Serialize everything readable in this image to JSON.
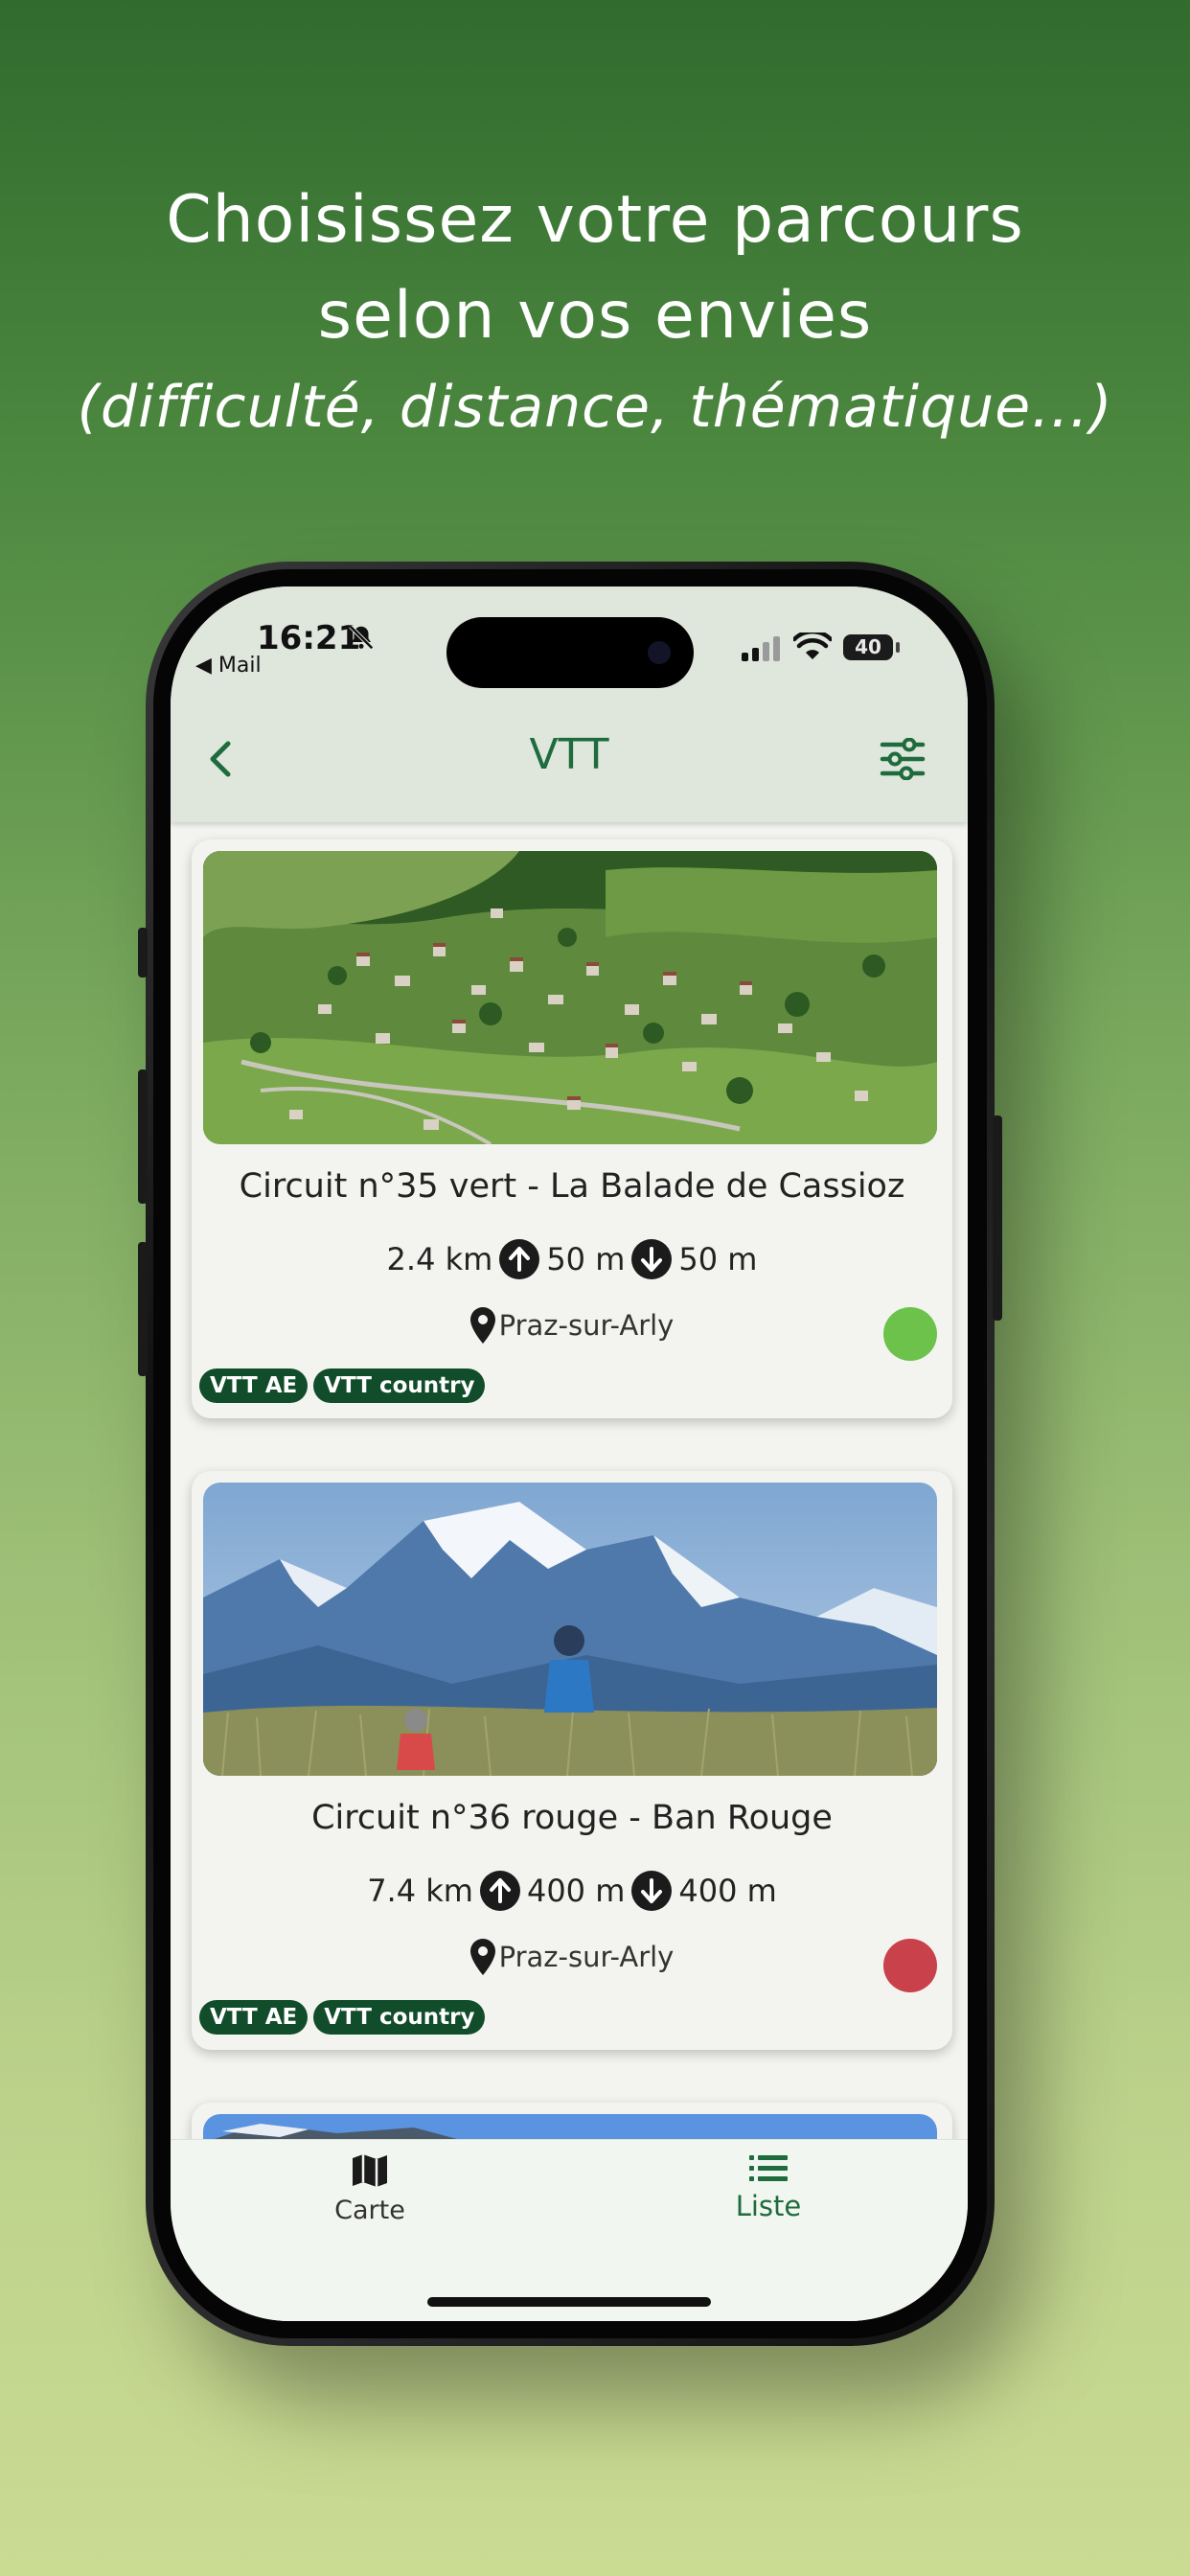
{
  "promo": {
    "line1": "Choisissez votre parcours",
    "line2": "selon vos envies",
    "line3": "(difficulté, distance, thématique…)"
  },
  "status_bar": {
    "time": "16:21",
    "back_app": "◀ Mail",
    "battery": "40"
  },
  "app_bar": {
    "title": "VTT",
    "back_icon": "chevron-left-icon",
    "filter_icon": "sliders-icon"
  },
  "routes": [
    {
      "title": "Circuit n°35 vert - La Balade de Cassioz",
      "distance": "2.4 km",
      "ascent": "50 m",
      "descent": "50 m",
      "location": "Praz-sur-Arly",
      "difficulty_color": "#6cc24a",
      "tags": [
        "VTT AE",
        "VTT country"
      ]
    },
    {
      "title": "Circuit n°36 rouge - Ban Rouge",
      "distance": "7.4 km",
      "ascent": "400 m",
      "descent": "400 m",
      "location": "Praz-sur-Arly",
      "difficulty_color": "#c8414b",
      "tags": [
        "VTT AE",
        "VTT country"
      ]
    }
  ],
  "tab_bar": {
    "tabs": [
      {
        "label": "Carte",
        "icon": "map-icon",
        "active": false
      },
      {
        "label": "Liste",
        "icon": "list-icon",
        "active": true
      }
    ]
  },
  "colors": {
    "primary": "#1e6b3d",
    "tag_bg": "#114d2a",
    "app_bar_bg": "#dfe6dc"
  }
}
